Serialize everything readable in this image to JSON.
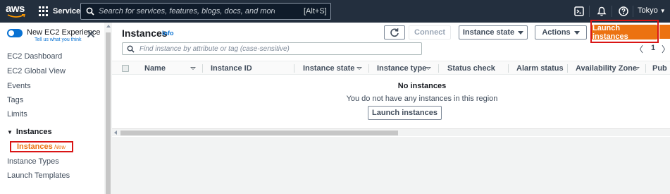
{
  "topnav": {
    "logo_text": "aws",
    "services_label": "Services",
    "search_placeholder": "Search for services, features, blogs, docs, and more",
    "search_shortcut": "[Alt+S]",
    "region_label": "Tokyo",
    "icons": [
      "cloudshell-icon",
      "bell-icon",
      "help-icon"
    ],
    "bg_color": "#232f3e"
  },
  "sidebar": {
    "toggle_title": "New EC2 Experience",
    "toggle_subtitle": "Tell us what you think",
    "items": [
      {
        "label": "EC2 Dashboard"
      },
      {
        "label": "EC2 Global View"
      },
      {
        "label": "Events"
      },
      {
        "label": "Tags"
      },
      {
        "label": "Limits"
      }
    ],
    "section_title": "Instances",
    "active_item": {
      "label": "Instances",
      "badge": "New"
    },
    "sub_items": [
      {
        "label": "Instance Types"
      },
      {
        "label": "Launch Templates"
      }
    ]
  },
  "main": {
    "title": "Instances",
    "info_label": "Info",
    "buttons": {
      "refresh": "refresh-icon",
      "connect": "Connect",
      "instance_state": "Instance state",
      "actions": "Actions",
      "launch": "Launch instances"
    },
    "filter_placeholder": "Find instance by attribute or tag (case-sensitive)",
    "pagination": {
      "current_page": "1"
    },
    "columns": [
      "Name",
      "Instance ID",
      "Instance state",
      "Instance type",
      "Status check",
      "Alarm status",
      "Availability Zone",
      "Pub"
    ],
    "empty_title": "No instances",
    "empty_message": "You do not have any instances in this region",
    "empty_button": "Launch instances",
    "accent_color": "#ec7211",
    "link_color": "#0972d3"
  }
}
